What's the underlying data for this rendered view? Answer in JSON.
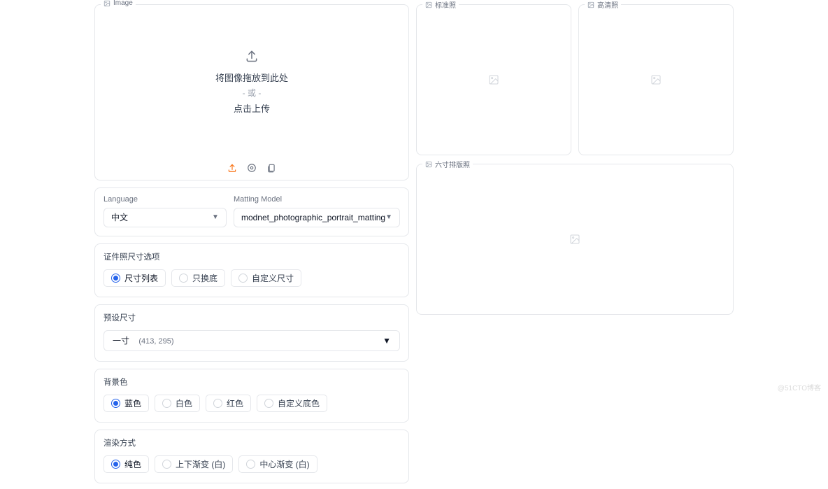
{
  "image_panel": {
    "label": "Image",
    "drop_text": "将图像拖放到此处",
    "or_text": "- 或 -",
    "click_text": "点击上传"
  },
  "language_field": {
    "label": "Language",
    "value": "中文"
  },
  "matting_field": {
    "label": "Matting Model",
    "value": "modnet_photographic_portrait_matting"
  },
  "size_option": {
    "title": "证件照尺寸选项",
    "options": [
      "尺寸列表",
      "只换底",
      "自定义尺寸"
    ],
    "selected": 0
  },
  "preset_size": {
    "title": "预设尺寸",
    "value": "一寸",
    "sub": "(413, 295)"
  },
  "bg_color": {
    "title": "背景色",
    "options": [
      "蓝色",
      "白色",
      "红色",
      "自定义底色"
    ],
    "selected": 0
  },
  "render_mode": {
    "title": "渲染方式",
    "options": [
      "纯色",
      "上下渐变 (白)",
      "中心渐变 (白)"
    ],
    "selected": 0
  },
  "outputs": {
    "standard": "标准照",
    "hd": "高清照",
    "layout": "六寸排版照"
  },
  "watermark": "@51CTO博客"
}
